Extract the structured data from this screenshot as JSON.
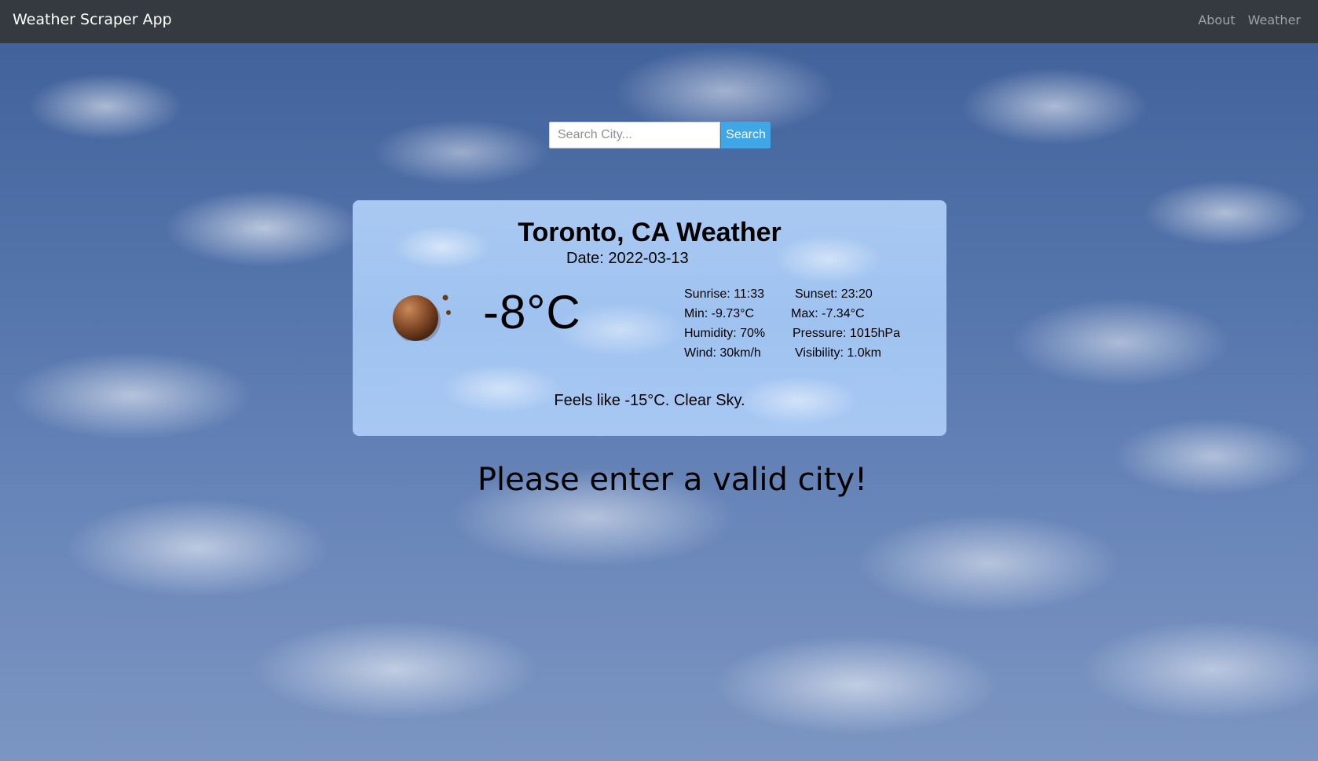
{
  "navbar": {
    "brand": "Weather Scraper App",
    "links": [
      "About",
      "Weather"
    ]
  },
  "search": {
    "placeholder": "Search City...",
    "value": "",
    "button_label": "Search"
  },
  "weather_card": {
    "title": "Toronto, CA Weather",
    "date": "Date: 2022-03-13",
    "icon": "weather-condition-icon",
    "temperature": "-8°C",
    "details": {
      "sunrise": "Sunrise: 11:33",
      "sunset": "Sunset: 23:20",
      "min": "Min: -9.73°C",
      "max": "Max: -7.34°C",
      "humidity": "Humidity: 70%",
      "pressure": "Pressure: 1015hPa",
      "wind": "Wind: 30km/h",
      "visibility": "Visibility: 1.0km"
    },
    "feels_like": "Feels like -15°C. Clear Sky."
  },
  "error_message": "Please enter a valid city!"
}
